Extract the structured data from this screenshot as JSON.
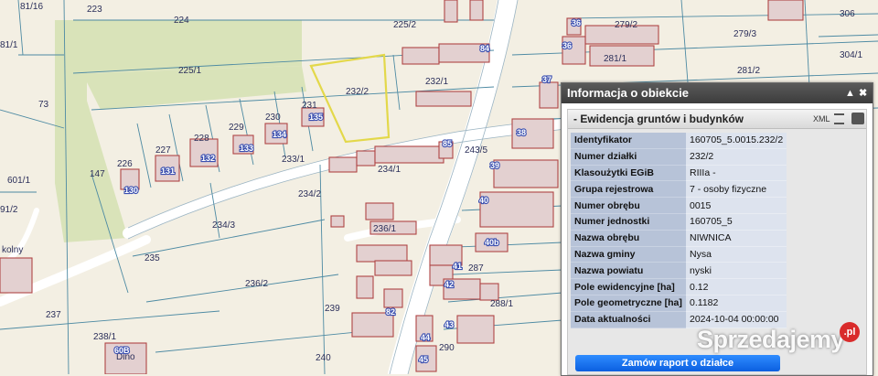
{
  "map": {
    "plots": [
      "223",
      "224",
      "225/2",
      "225/1",
      "232/2",
      "232/1",
      "231",
      "230",
      "229",
      "228",
      "227",
      "226",
      "233/1",
      "234/1",
      "234/2",
      "234/3",
      "236/1",
      "236/2",
      "235",
      "239",
      "240",
      "238/1",
      "237",
      "243/5",
      "279/2",
      "279/3",
      "281/1",
      "281/2",
      "287",
      "288/1",
      "290",
      "306",
      "304/1",
      "601/1",
      "147",
      "73",
      "81/16",
      "81/1",
      "91/2"
    ],
    "buildings": [
      "36",
      "35",
      "36",
      "37",
      "38",
      "39",
      "40",
      "40b",
      "41",
      "42",
      "43",
      "44",
      "45",
      "82",
      "84",
      "85",
      "130",
      "131",
      "132",
      "133",
      "134",
      "135",
      "60B"
    ],
    "road_labels": [
      "Dino",
      "kolny"
    ]
  },
  "panel": {
    "title": "Informacja o obiekcie",
    "minimize_glyph": "▲",
    "close_glyph": "✖",
    "section_title": "-  Ewidencja gruntów i budynków",
    "xml_label": "XML",
    "rows": [
      {
        "key": "Identyfikator",
        "value": "160705_5.0015.232/2"
      },
      {
        "key": "Numer działki",
        "value": "232/2"
      },
      {
        "key": "Klasoużytki EGiB",
        "value": "RIIIa -"
      },
      {
        "key": "Grupa rejestrowa",
        "value": "7 - osoby fizyczne"
      },
      {
        "key": "Numer obrębu",
        "value": "0015"
      },
      {
        "key": "Numer jednostki",
        "value": "160705_5"
      },
      {
        "key": "Nazwa obrębu",
        "value": "NIWNICA"
      },
      {
        "key": "Nazwa gminy",
        "value": "Nysa"
      },
      {
        "key": "Nazwa powiatu",
        "value": "nyski"
      },
      {
        "key": "Pole ewidencyjne [ha]",
        "value": "0.12"
      },
      {
        "key": "Pole geometryczne [ha]",
        "value": "0.1182"
      },
      {
        "key": "Data aktualności",
        "value": "2024-10-04 00:00:00"
      }
    ],
    "report_button": "Zamów raport o działce"
  },
  "watermark": {
    "text": "Sprzedajemy",
    "badge": ".pl"
  },
  "colors": {
    "background": "#f3efe3",
    "green_area": "#d9e3b9",
    "plot_line": "#4d8aa3",
    "building_fill": "#e3d0d0",
    "building_stroke": "#b04545",
    "highlight": "#e3d84a",
    "road": "#ffffff"
  }
}
